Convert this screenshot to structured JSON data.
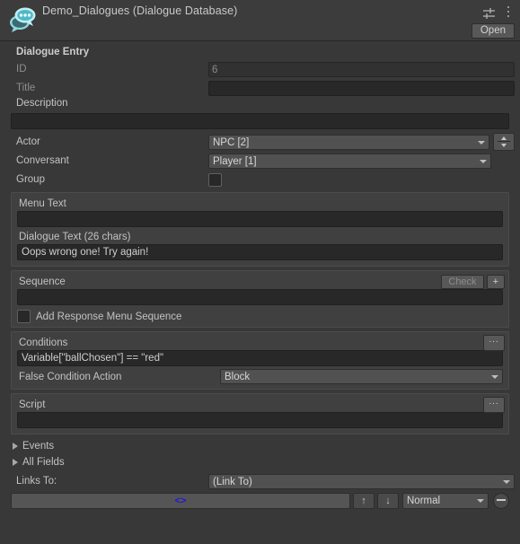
{
  "header": {
    "title": "Demo_Dialogues (Dialogue Database)",
    "icon": "dialogue-bubble-icon",
    "preset_icon": "preset-sliders-icon",
    "menu_icon": "kebab-menu-icon",
    "open_label": "Open"
  },
  "entry": {
    "section_title": "Dialogue Entry",
    "id_label": "ID",
    "id_value": "6",
    "title_label": "Title",
    "title_value": "",
    "description_label": "Description",
    "description_value": "",
    "actor_label": "Actor",
    "actor_value": "NPC [2]",
    "conversant_label": "Conversant",
    "conversant_value": "Player [1]",
    "group_label": "Group",
    "group_checked": false
  },
  "text_panel": {
    "menu_text_label": "Menu Text",
    "menu_text_value": "",
    "dialogue_text_label": "Dialogue Text (26 chars)",
    "dialogue_text_value": "Oops wrong one! Try again!"
  },
  "sequence": {
    "title": "Sequence",
    "check_label": "Check",
    "add_label": "+",
    "value": "",
    "response_menu_label": "Add Response Menu Sequence",
    "response_menu_checked": false
  },
  "conditions": {
    "title": "Conditions",
    "menu_label": "...",
    "value": "Variable[\"ballChosen\"] == \"red\"",
    "false_action_label": "False Condition Action",
    "false_action_value": "Block"
  },
  "script": {
    "title": "Script",
    "menu_label": "...",
    "value": ""
  },
  "footer": {
    "events_label": "Events",
    "all_fields_label": "All Fields",
    "links_to_label": "Links To:",
    "links_to_value": "(Link To)",
    "link_entry_value": "<>",
    "move_up_label": "↑",
    "move_down_label": "↓",
    "link_priority_value": "Normal",
    "remove_label": "remove-link-button"
  },
  "colors": {
    "window_bg": "#383838",
    "header_bg": "#3c3c3c",
    "panel_bg": "#404040",
    "field_bg": "#282828",
    "popup_bg": "#515151",
    "text": "#c4c4c4",
    "link_accent": "#1c15e0",
    "icon_accent": "#7fd3da"
  }
}
